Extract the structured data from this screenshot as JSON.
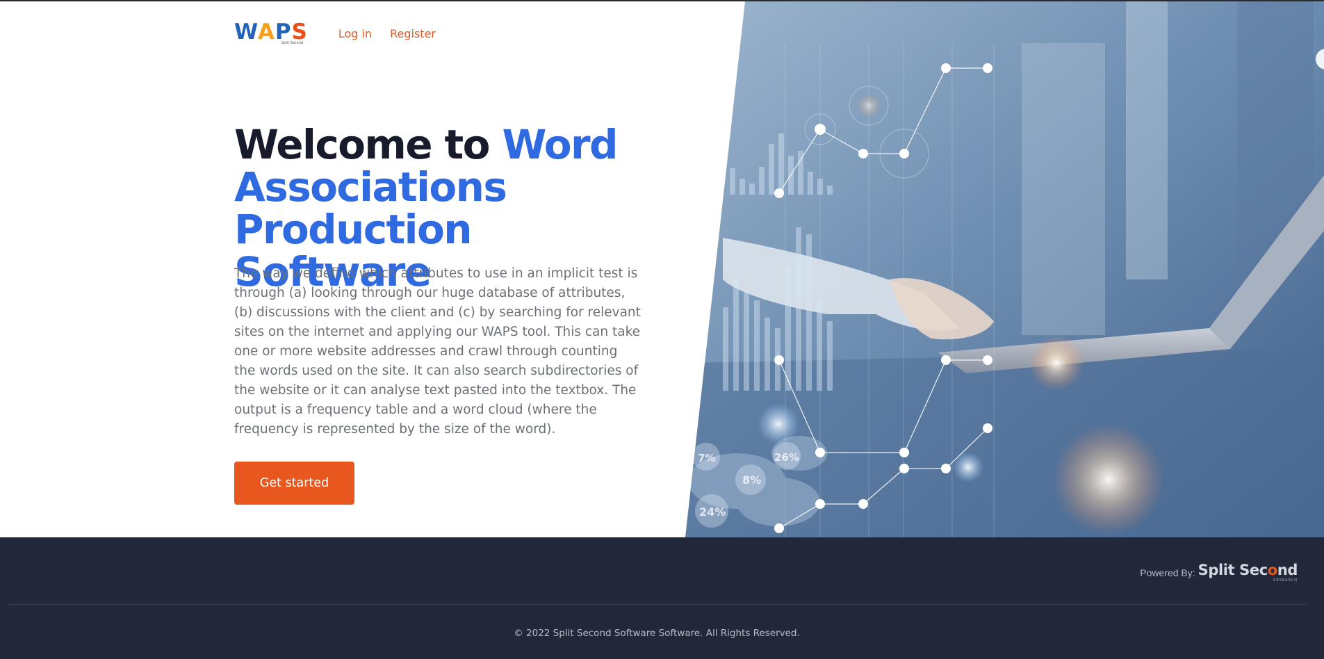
{
  "brand": {
    "logo_letters": [
      "W",
      "A",
      "P",
      "S"
    ],
    "logo_sub": "Split Second"
  },
  "nav": {
    "login": "Log in",
    "register": "Register"
  },
  "hero": {
    "title_prefix": "Welcome to ",
    "title_highlight_line1": "Word",
    "title_highlight_line2": "Associations",
    "title_highlight_line3": "Production Software",
    "description": "The way we define which attributes to use in an implicit test is through (a) looking through our huge database of attributes, (b) discussions with the client and (c) by searching for relevant sites on the internet and applying our WAPS tool. This can take one or more website addresses and crawl through counting the words used on the site. It can also search subdirectories of the website or it can analyse text pasted into the textbox. The output is a frequency table and a word cloud (where the frequency is represented by the size of the word).",
    "cta_label": "Get started",
    "image_labels": [
      "7%",
      "26%",
      "8%",
      "24%"
    ]
  },
  "footer": {
    "powered_label": "Powered By:",
    "brand_name_part1": "Split Sec",
    "brand_name_o": "o",
    "brand_name_part2": "nd",
    "brand_sub": "RESEARCH",
    "copyright": "© 2022 Split Second Software Software. All Rights Reserved."
  },
  "colors": {
    "accent_blue": "#2f6ae1",
    "cta_orange": "#e8571d",
    "footer_bg": "#202839",
    "headline_dark": "#181b2b"
  }
}
